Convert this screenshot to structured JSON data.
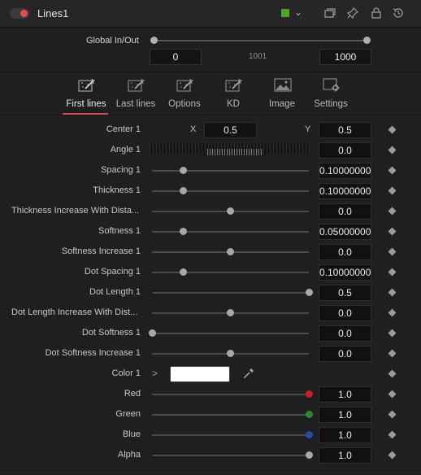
{
  "header": {
    "title": "Lines1",
    "accent": "#4aa62a",
    "toggle_color": "#e74b4b",
    "icons": [
      "toggle-icon",
      "color-swatch-icon",
      "chevron-down-icon",
      "window-icon",
      "pin-icon",
      "lock-icon",
      "reset-icon"
    ]
  },
  "global": {
    "label": "Global In/Out",
    "start": "0",
    "middle": "1001",
    "end": "1000"
  },
  "tabs": [
    {
      "label": "First lines",
      "icon": "magic-wand-icon",
      "active": true
    },
    {
      "label": "Last lines",
      "icon": "magic-wand-icon",
      "active": false
    },
    {
      "label": "Options",
      "icon": "magic-wand-icon",
      "active": false
    },
    {
      "label": "KD",
      "icon": "magic-wand-icon",
      "active": false
    },
    {
      "label": "Image",
      "icon": "image-icon",
      "active": false
    },
    {
      "label": "Settings",
      "icon": "gear-icon",
      "active": false
    }
  ],
  "params": {
    "center": {
      "label": "Center 1",
      "x_label": "X",
      "x": "0.5",
      "y_label": "Y",
      "y": "0.5"
    },
    "angle": {
      "label": "Angle 1",
      "value": "0.0"
    },
    "sliders": [
      {
        "label": "Spacing 1",
        "value": "0.10000000",
        "position": 0.2
      },
      {
        "label": "Thickness 1",
        "value": "0.10000000",
        "position": 0.2
      },
      {
        "label": "Thickness Increase With Dista...",
        "value": "0.0",
        "position": 0.5
      },
      {
        "label": "Softness 1",
        "value": "0.05000000",
        "position": 0.2
      },
      {
        "label": "Softness Increase 1",
        "value": "0.0",
        "position": 0.5
      },
      {
        "label": "Dot Spacing 1",
        "value": "0.10000000",
        "position": 0.2
      },
      {
        "label": "Dot Length 1",
        "value": "0.5",
        "position": 1.0
      },
      {
        "label": "Dot Length Increase With Dist...",
        "value": "0.0",
        "position": 0.5
      },
      {
        "label": "Dot Softness 1",
        "value": "0.0",
        "position": 0.0
      },
      {
        "label": "Dot Softness Increase 1",
        "value": "0.0",
        "position": 0.5
      }
    ],
    "color": {
      "label": "Color 1",
      "swatch": "#ffffff"
    },
    "channels": [
      {
        "label": "Red",
        "value": "1.0",
        "position": 1.0,
        "color": "#c91f1f"
      },
      {
        "label": "Green",
        "value": "1.0",
        "position": 1.0,
        "color": "#2a8a2a"
      },
      {
        "label": "Blue",
        "value": "1.0",
        "position": 1.0,
        "color": "#1f4fa8"
      },
      {
        "label": "Alpha",
        "value": "1.0",
        "position": 1.0,
        "color": "#a8a8a8"
      }
    ]
  }
}
